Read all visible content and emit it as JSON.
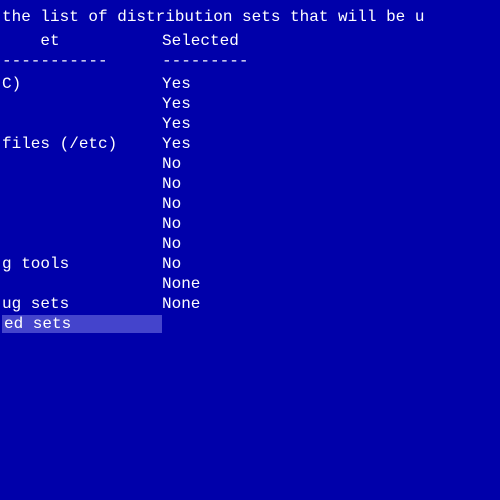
{
  "header": {
    "text": "the list of distribution sets that will be u"
  },
  "columns": {
    "set": "Set",
    "selected": "Selected"
  },
  "dividers": {
    "set": "-----------",
    "selected": "---------"
  },
  "rows": [
    {
      "name": "C)",
      "value": "Yes",
      "highlighted": false
    },
    {
      "name": "",
      "value": "Yes",
      "highlighted": false
    },
    {
      "name": "",
      "value": "Yes",
      "highlighted": false
    },
    {
      "name": "files (/etc)",
      "value": "Yes",
      "highlighted": false
    },
    {
      "name": "",
      "value": "No",
      "highlighted": false
    },
    {
      "name": "",
      "value": "No",
      "highlighted": false
    },
    {
      "name": "",
      "value": "No",
      "highlighted": false
    },
    {
      "name": "",
      "value": "No",
      "highlighted": false
    },
    {
      "name": "",
      "value": "No",
      "highlighted": false
    },
    {
      "name": "g tools",
      "value": "No",
      "highlighted": false
    },
    {
      "name": "",
      "value": "None",
      "highlighted": false
    },
    {
      "name": "ug sets",
      "value": "None",
      "highlighted": false
    },
    {
      "name": "ed sets",
      "value": "",
      "highlighted": true
    }
  ]
}
